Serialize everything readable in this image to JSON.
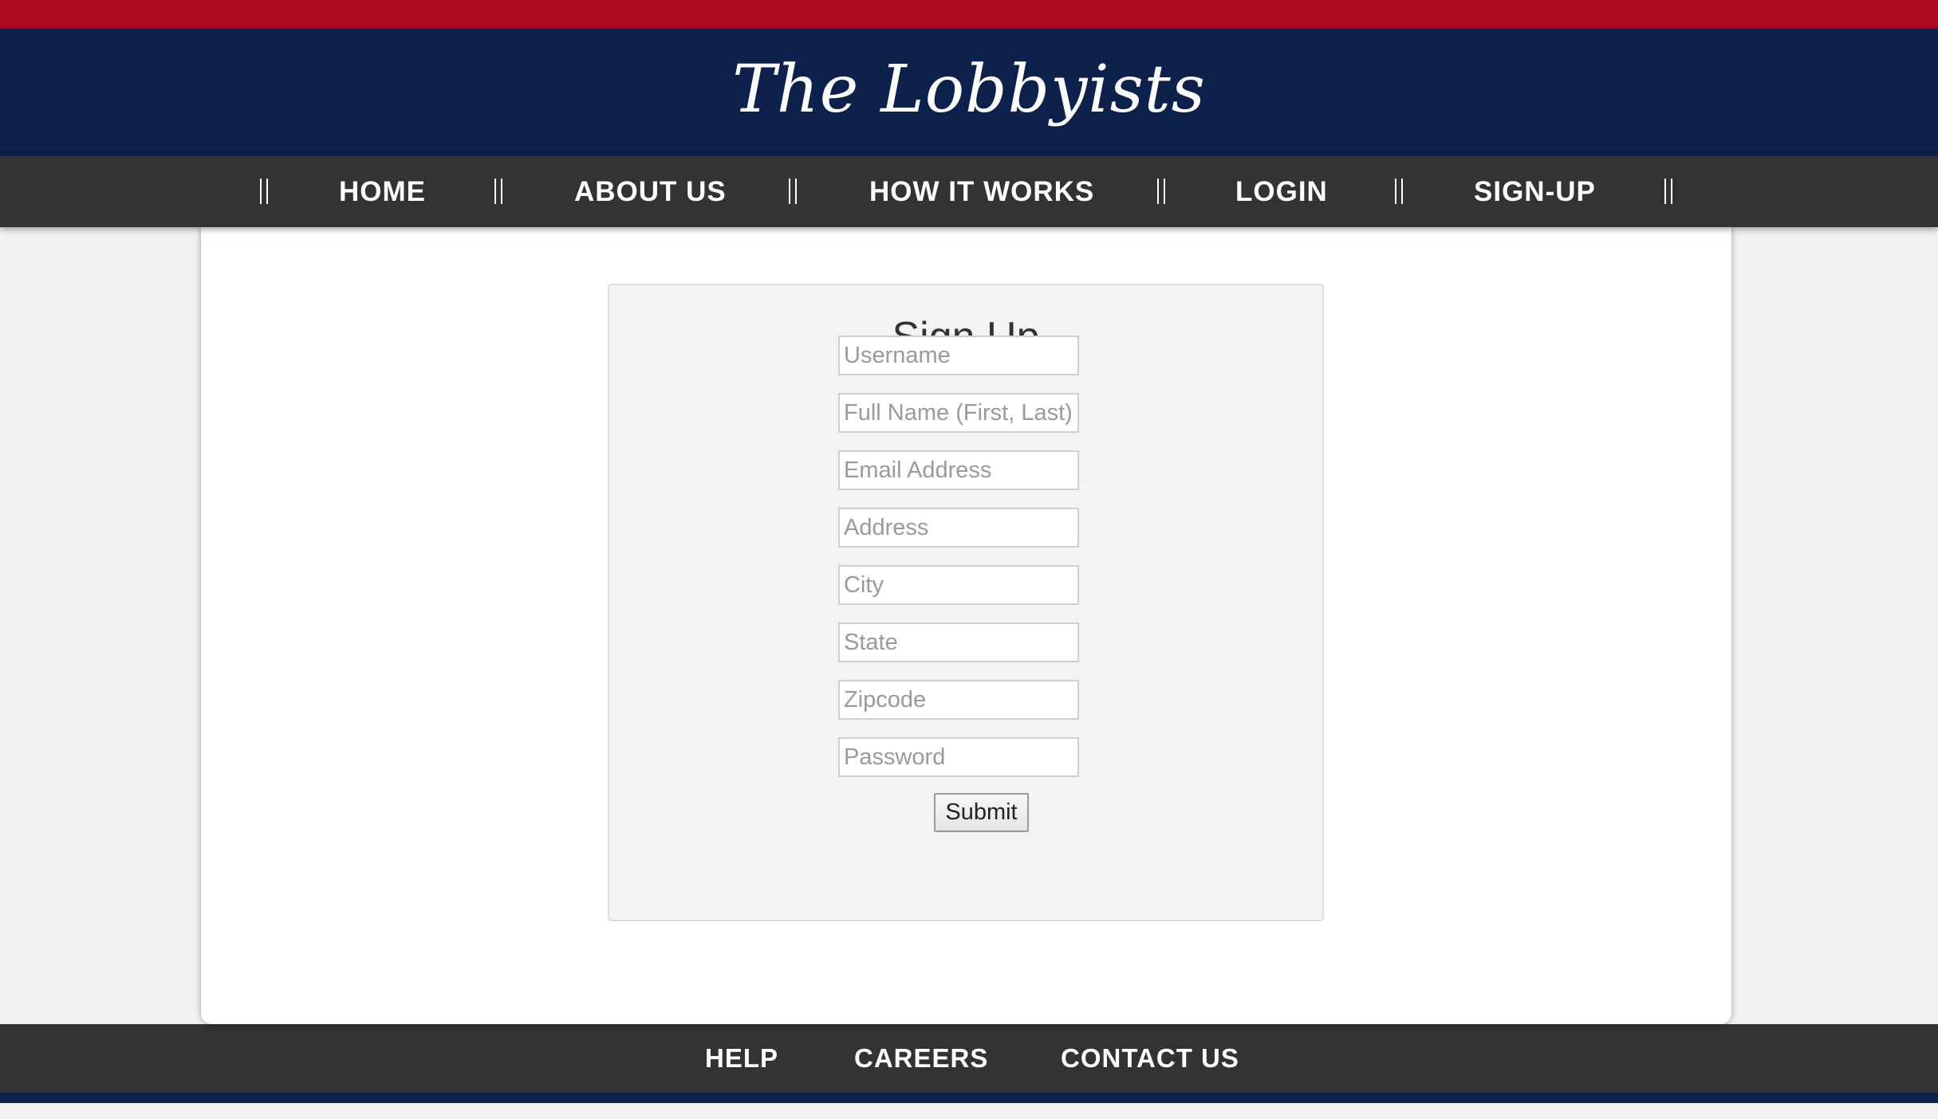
{
  "header": {
    "site_title": "The Lobbyists",
    "colors": {
      "top_stripe": "#ac0820",
      "header_bg": "#0c214b",
      "nav_bg": "#333333"
    }
  },
  "nav": {
    "items": [
      {
        "label": "HOME"
      },
      {
        "label": "ABOUT US"
      },
      {
        "label": "HOW IT WORKS"
      },
      {
        "label": "LOGIN"
      },
      {
        "label": "SIGN-UP"
      }
    ]
  },
  "signup": {
    "title": "Sign Up",
    "fields": [
      {
        "placeholder": "Username",
        "value": ""
      },
      {
        "placeholder": "Full Name (First, Last)",
        "value": ""
      },
      {
        "placeholder": "Email Address",
        "value": ""
      },
      {
        "placeholder": "Address",
        "value": ""
      },
      {
        "placeholder": "City",
        "value": ""
      },
      {
        "placeholder": "State",
        "value": ""
      },
      {
        "placeholder": "Zipcode",
        "value": ""
      },
      {
        "placeholder": "Password",
        "value": ""
      }
    ],
    "submit_label": "Submit"
  },
  "footer": {
    "links": [
      {
        "label": "HELP"
      },
      {
        "label": "CAREERS"
      },
      {
        "label": "CONTACT US"
      }
    ]
  }
}
